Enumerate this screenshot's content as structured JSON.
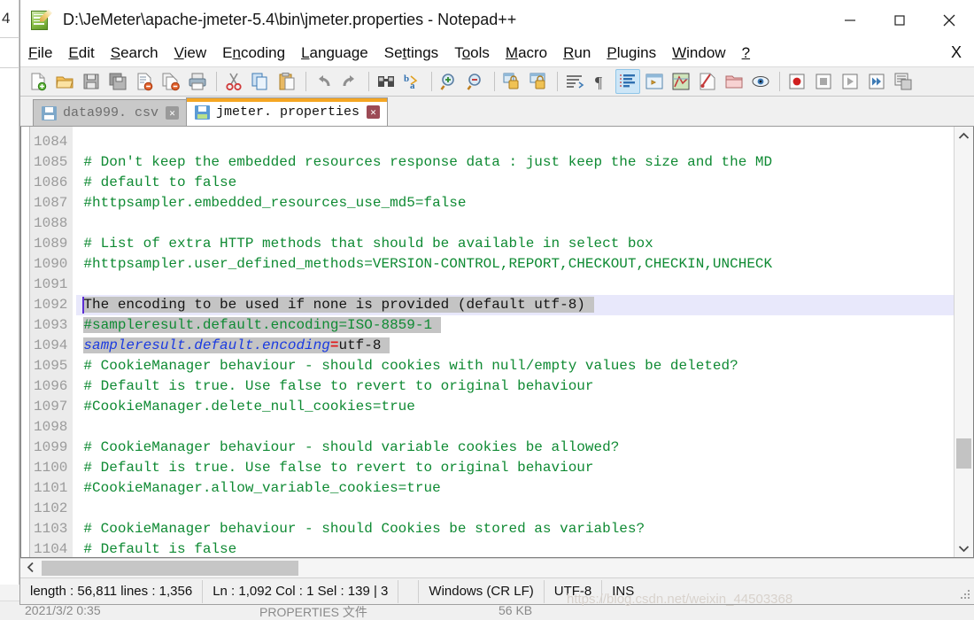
{
  "window": {
    "title": "D:\\JeMeter\\apache-jmeter-5.4\\bin\\jmeter.properties - Notepad++",
    "app_icon": "notepad-plus-plus-icon",
    "minimize_label": "—",
    "maximize_label": "□",
    "close_label": "✕"
  },
  "menubar": {
    "items": [
      {
        "label": "File",
        "mnemonic": "F"
      },
      {
        "label": "Edit",
        "mnemonic": "E"
      },
      {
        "label": "Search",
        "mnemonic": "S"
      },
      {
        "label": "View",
        "mnemonic": "V"
      },
      {
        "label": "Encoding",
        "mnemonic": "n"
      },
      {
        "label": "Language",
        "mnemonic": "L"
      },
      {
        "label": "Settings",
        "mnemonic": "t"
      },
      {
        "label": "Tools",
        "mnemonic": "o"
      },
      {
        "label": "Macro",
        "mnemonic": "M"
      },
      {
        "label": "Run",
        "mnemonic": "R"
      },
      {
        "label": "Plugins",
        "mnemonic": "P"
      },
      {
        "label": "Window",
        "mnemonic": "W"
      },
      {
        "label": "?",
        "mnemonic": "?"
      }
    ],
    "close_document_label": "X"
  },
  "toolbar": {
    "buttons": [
      {
        "name": "new-file-icon"
      },
      {
        "name": "open-file-icon"
      },
      {
        "name": "save-icon"
      },
      {
        "name": "save-all-icon"
      },
      {
        "name": "close-file-icon"
      },
      {
        "name": "close-all-files-icon"
      },
      {
        "name": "print-icon"
      },
      {
        "name": "separator"
      },
      {
        "name": "cut-icon"
      },
      {
        "name": "copy-icon"
      },
      {
        "name": "paste-icon"
      },
      {
        "name": "separator"
      },
      {
        "name": "undo-icon"
      },
      {
        "name": "redo-icon"
      },
      {
        "name": "separator"
      },
      {
        "name": "find-icon"
      },
      {
        "name": "replace-icon"
      },
      {
        "name": "separator"
      },
      {
        "name": "zoom-in-icon"
      },
      {
        "name": "zoom-out-icon"
      },
      {
        "name": "separator"
      },
      {
        "name": "sync-vertical-scroll-icon"
      },
      {
        "name": "sync-horizontal-scroll-icon"
      },
      {
        "name": "separator"
      },
      {
        "name": "word-wrap-icon"
      },
      {
        "name": "show-all-characters-icon"
      },
      {
        "name": "show-indent-guide-icon",
        "active": true
      },
      {
        "name": "user-defined-language-icon"
      },
      {
        "name": "document-map-icon"
      },
      {
        "name": "function-list-icon"
      },
      {
        "name": "folder-as-workspace-icon"
      },
      {
        "name": "monitoring-icon"
      },
      {
        "name": "separator"
      },
      {
        "name": "macro-record-icon"
      },
      {
        "name": "macro-stop-icon"
      },
      {
        "name": "macro-playback-icon"
      },
      {
        "name": "macro-run-multiple-icon"
      },
      {
        "name": "save-macro-icon"
      }
    ]
  },
  "tabs": [
    {
      "label": "data999. csv",
      "active": false,
      "icon": "floppy-disk-icon",
      "close": "✕"
    },
    {
      "label": "jmeter. properties",
      "active": true,
      "icon": "floppy-disk-icon",
      "close": "✕"
    }
  ],
  "editor": {
    "first_line": 1084,
    "lines": [
      {
        "num": "1084",
        "segments": []
      },
      {
        "num": "1085",
        "segments": [
          {
            "text": "# Don't keep the embedded resources response data : just keep the size and the MD",
            "cls": "c-comment"
          }
        ]
      },
      {
        "num": "1086",
        "segments": [
          {
            "text": "# default to false",
            "cls": "c-comment"
          }
        ]
      },
      {
        "num": "1087",
        "segments": [
          {
            "text": "#httpsampler.embedded_resources_use_md5=false",
            "cls": "c-comment"
          }
        ]
      },
      {
        "num": "1088",
        "segments": []
      },
      {
        "num": "1089",
        "segments": [
          {
            "text": "# List of extra HTTP methods that should be available in select box",
            "cls": "c-comment"
          }
        ]
      },
      {
        "num": "1090",
        "segments": [
          {
            "text": "#httpsampler.user_defined_methods=VERSION-CONTROL,REPORT,CHECKOUT,CHECKIN,UNCHECK",
            "cls": "c-comment"
          }
        ]
      },
      {
        "num": "1091",
        "segments": []
      },
      {
        "num": "1092",
        "current": true,
        "caret": true,
        "segments": [
          {
            "text": "The encoding to be used if none is provided (default utf-8) ",
            "cls": "c-plain",
            "sel": true
          }
        ]
      },
      {
        "num": "1093",
        "segments": [
          {
            "text": "#sampleresult.default.encoding=ISO-8859-1 ",
            "cls": "c-comment",
            "sel": true
          }
        ]
      },
      {
        "num": "1094",
        "segments": [
          {
            "text": "sampleresult.default.encoding",
            "cls": "c-key",
            "sel": true
          },
          {
            "text": "=",
            "cls": "c-eq",
            "sel": true
          },
          {
            "text": "utf-8 ",
            "cls": "c-val",
            "sel": true
          }
        ]
      },
      {
        "num": "1095",
        "segments": [
          {
            "text": "# CookieManager behaviour - should cookies with null/empty values be deleted?",
            "cls": "c-comment"
          }
        ]
      },
      {
        "num": "1096",
        "segments": [
          {
            "text": "# Default is true. Use false to revert to original behaviour",
            "cls": "c-comment"
          }
        ]
      },
      {
        "num": "1097",
        "segments": [
          {
            "text": "#CookieManager.delete_null_cookies=true",
            "cls": "c-comment"
          }
        ]
      },
      {
        "num": "1098",
        "segments": []
      },
      {
        "num": "1099",
        "segments": [
          {
            "text": "# CookieManager behaviour - should variable cookies be allowed?",
            "cls": "c-comment"
          }
        ]
      },
      {
        "num": "1100",
        "segments": [
          {
            "text": "# Default is true. Use false to revert to original behaviour",
            "cls": "c-comment"
          }
        ]
      },
      {
        "num": "1101",
        "segments": [
          {
            "text": "#CookieManager.allow_variable_cookies=true",
            "cls": "c-comment"
          }
        ]
      },
      {
        "num": "1102",
        "segments": []
      },
      {
        "num": "1103",
        "segments": [
          {
            "text": "# CookieManager behaviour - should Cookies be stored as variables?",
            "cls": "c-comment"
          }
        ]
      },
      {
        "num": "1104",
        "segments": [
          {
            "text": "# Default is false",
            "cls": "c-comment"
          }
        ]
      }
    ]
  },
  "statusbar": {
    "length_lines": "length : 56,811   lines : 1,356",
    "position": "Ln : 1,092   Col : 1   Sel : 139 | 3",
    "eol": "Windows (CR LF)",
    "encoding": "UTF-8",
    "insert_mode": "INS"
  },
  "background": {
    "left_edge_number": "4",
    "explorer_row": {
      "date": "2021/3/2 0:35",
      "type": "PROPERTIES 文件",
      "size": "56 KB"
    }
  },
  "watermark": "https://blog.csdn.net/weixin_44503368"
}
